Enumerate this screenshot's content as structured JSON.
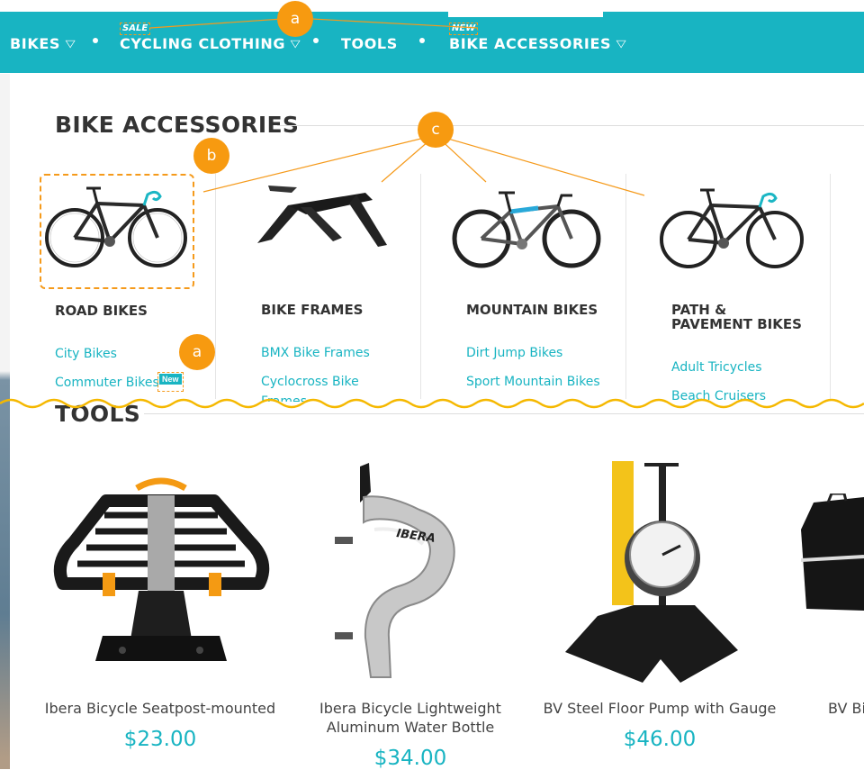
{
  "nav": {
    "items": [
      {
        "label": "BIKES",
        "dropdown": true
      },
      {
        "label": "CYCLING CLOTHING",
        "dropdown": true,
        "badge": "SALE"
      },
      {
        "label": "TOOLS",
        "dropdown": false
      },
      {
        "label": "BIKE ACCESSORIES",
        "dropdown": true,
        "badge": "NEW"
      }
    ],
    "chevron": "▽"
  },
  "callouts": {
    "a": "a",
    "b": "b",
    "c": "c"
  },
  "accessories": {
    "title": "BIKE ACCESSORIES",
    "categories": [
      {
        "name": "ROAD BIKES",
        "links": [
          "City Bikes",
          "Commuter Bikes"
        ],
        "link_badge": "New"
      },
      {
        "name": "BIKE FRAMES",
        "links": [
          "BMX Bike Frames",
          "Cyclocross Bike",
          "Frames"
        ]
      },
      {
        "name": "MOUNTAIN BIKES",
        "links": [
          "Dirt Jump Bikes",
          "Sport Mountain Bikes"
        ]
      },
      {
        "name_line1": "PATH &",
        "name_line2": "PAVEMENT BIKES",
        "links": [
          "Adult Tricycles",
          "Beach Cruisers"
        ]
      }
    ]
  },
  "tools": {
    "title": "TOOLS",
    "products": [
      {
        "name": "Ibera Bicycle Seatpost-mounted",
        "price": "$23.00"
      },
      {
        "name_line1": "Ibera Bicycle Lightweight",
        "name_line2": "Aluminum Water Bottle",
        "price": "$34.00"
      },
      {
        "name": "BV Steel Floor Pump with Gauge",
        "price": "$46.00"
      },
      {
        "name": "BV Bic",
        "price": ""
      }
    ],
    "bottle_brand": "IBERA"
  },
  "colors": {
    "accent": "#18b4c2",
    "callout": "#f79a10",
    "wave": "#f5b800"
  }
}
